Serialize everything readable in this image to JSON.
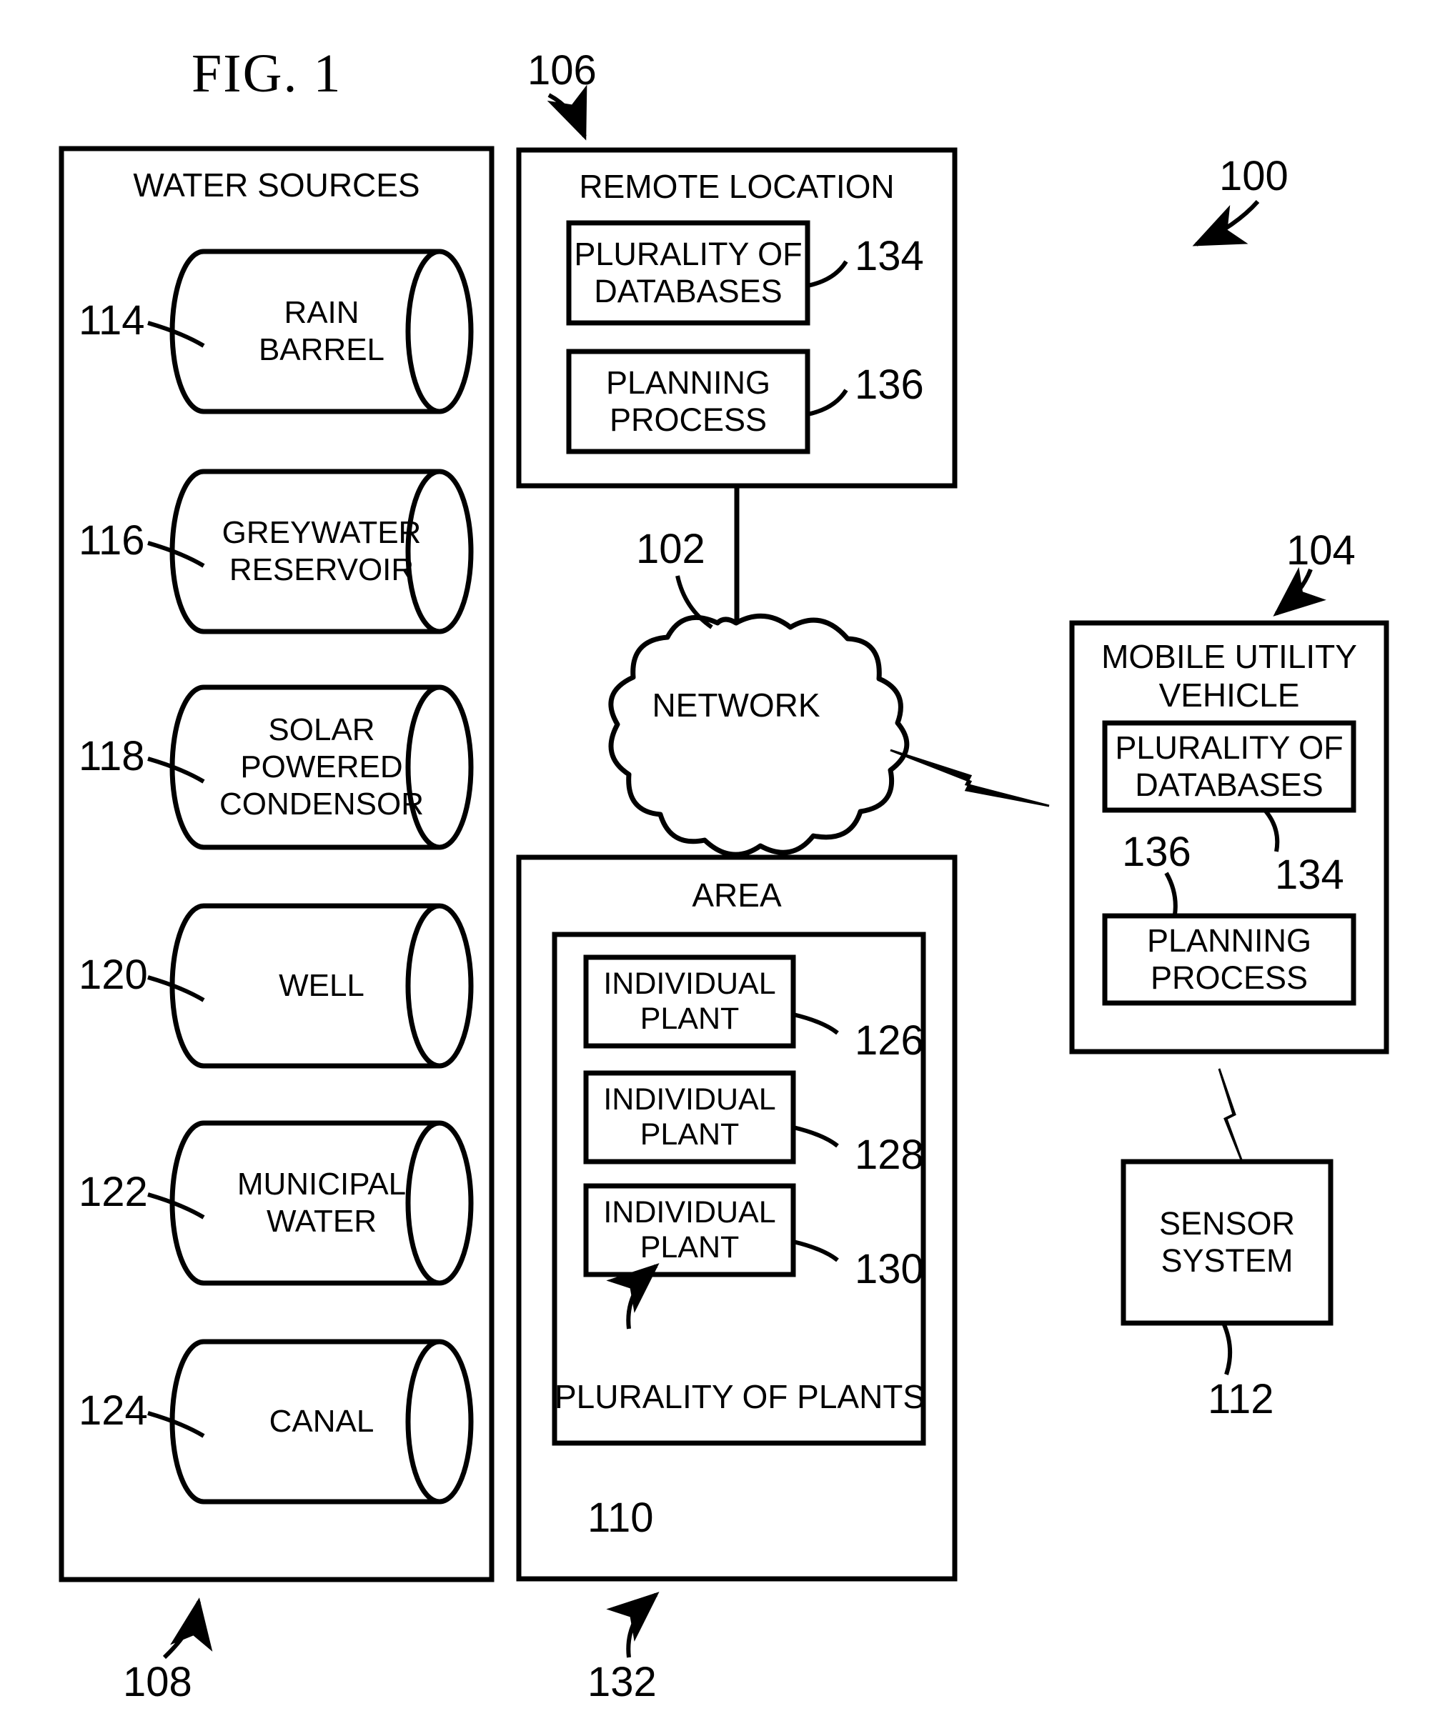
{
  "figure": {
    "title": "FIG. 1",
    "system_ref": "100"
  },
  "water_sources": {
    "title": "WATER SOURCES",
    "ref": "108",
    "items": [
      {
        "ref": "114",
        "line1": "RAIN",
        "line2": "BARREL",
        "line3": ""
      },
      {
        "ref": "116",
        "line1": "GREYWATER",
        "line2": "RESERVOIR",
        "line3": ""
      },
      {
        "ref": "118",
        "line1": "SOLAR",
        "line2": "POWERED",
        "line3": "CONDENSOR"
      },
      {
        "ref": "120",
        "line1": "WELL",
        "line2": "",
        "line3": ""
      },
      {
        "ref": "122",
        "line1": "MUNICIPAL",
        "line2": "WATER",
        "line3": ""
      },
      {
        "ref": "124",
        "line1": "CANAL",
        "line2": "",
        "line3": ""
      }
    ]
  },
  "remote_location": {
    "title": "REMOTE LOCATION",
    "ref": "106",
    "databases": {
      "line1": "PLURALITY OF",
      "line2": "DATABASES",
      "ref": "134"
    },
    "planning": {
      "line1": "PLANNING",
      "line2": "PROCESS",
      "ref": "136"
    }
  },
  "network": {
    "label": "NETWORK",
    "ref": "102"
  },
  "mobile_utility_vehicle": {
    "title_line1": "MOBILE UTILITY",
    "title_line2": "VEHICLE",
    "ref": "104",
    "databases": {
      "line1": "PLURALITY OF",
      "line2": "DATABASES",
      "ref": "134"
    },
    "planning": {
      "line1": "PLANNING",
      "line2": "PROCESS",
      "ref": "136"
    }
  },
  "sensor_system": {
    "line1": "SENSOR",
    "line2": "SYSTEM",
    "ref": "112"
  },
  "area": {
    "title": "AREA",
    "ref": "132",
    "plurality_of_plants": {
      "label": "PLURALITY OF PLANTS",
      "ref": "110",
      "plants": [
        {
          "line1": "INDIVIDUAL",
          "line2": "PLANT",
          "ref": "126"
        },
        {
          "line1": "INDIVIDUAL",
          "line2": "PLANT",
          "ref": "128"
        },
        {
          "line1": "INDIVIDUAL",
          "line2": "PLANT",
          "ref": "130"
        }
      ]
    }
  },
  "colors": {
    "ink": "#000000",
    "paper": "#ffffff"
  }
}
